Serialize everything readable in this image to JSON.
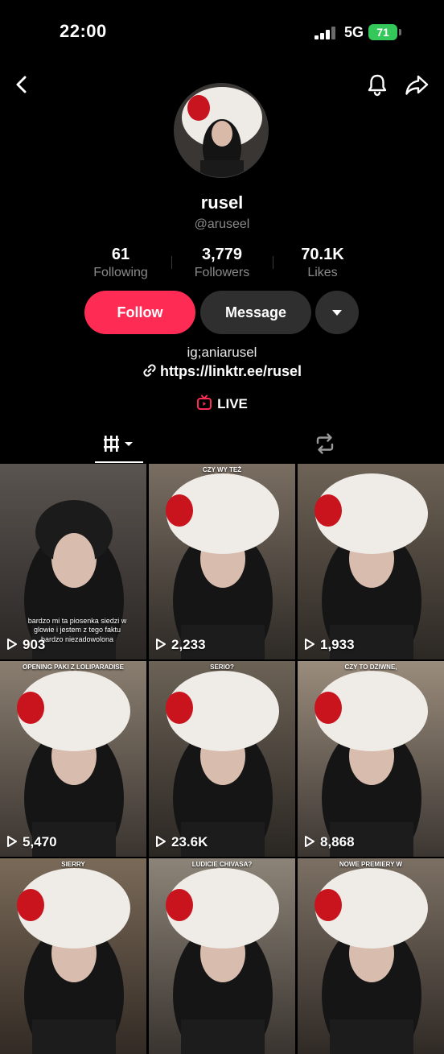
{
  "status_bar": {
    "time": "22:00",
    "network": "5G",
    "battery": "71"
  },
  "colors": {
    "accent": "#fe2c55",
    "button_dark": "#2f2f2f",
    "muted_text": "#8a8a8a",
    "battery": "#34c759"
  },
  "profile": {
    "display_name": "rusel",
    "username": "@aruseel",
    "stats": [
      {
        "value": "61",
        "label": "Following"
      },
      {
        "value": "3,779",
        "label": "Followers"
      },
      {
        "value": "70.1K",
        "label": "Likes"
      }
    ],
    "follow_label": "Follow",
    "message_label": "Message",
    "bio": "ig;aniarusel",
    "link": "https://linktr.ee/rusel",
    "live_label": "LIVE"
  },
  "icons": [
    "back-icon",
    "bell-icon",
    "share-icon",
    "dropdown-chevron-icon",
    "link-icon",
    "live-tv-icon",
    "grid-videos-icon",
    "repost-icon",
    "play-icon"
  ],
  "videos": [
    {
      "views": "903",
      "caption": "",
      "subtitle": "bardzo mi ta piosenka siedzi w glowie i jestem z tego faktu bardzo niezadowolona"
    },
    {
      "views": "2,233",
      "caption": "CZY WY TEŻ",
      "subtitle": ""
    },
    {
      "views": "1,933",
      "caption": "",
      "subtitle": ""
    },
    {
      "views": "5,470",
      "caption": "OPENING PAKI Z LOLIPARADISE",
      "subtitle": ""
    },
    {
      "views": "23.6K",
      "caption": "SERIO?",
      "subtitle": ""
    },
    {
      "views": "8,868",
      "caption": "CZY TO DZIWNE,",
      "subtitle": ""
    },
    {
      "views": "",
      "caption": "SIERRY",
      "subtitle": ""
    },
    {
      "views": "",
      "caption": "LUDICIE CHIVASA?",
      "subtitle": ""
    },
    {
      "views": "",
      "caption": "NOWE PREMIERY W",
      "subtitle": ""
    }
  ]
}
